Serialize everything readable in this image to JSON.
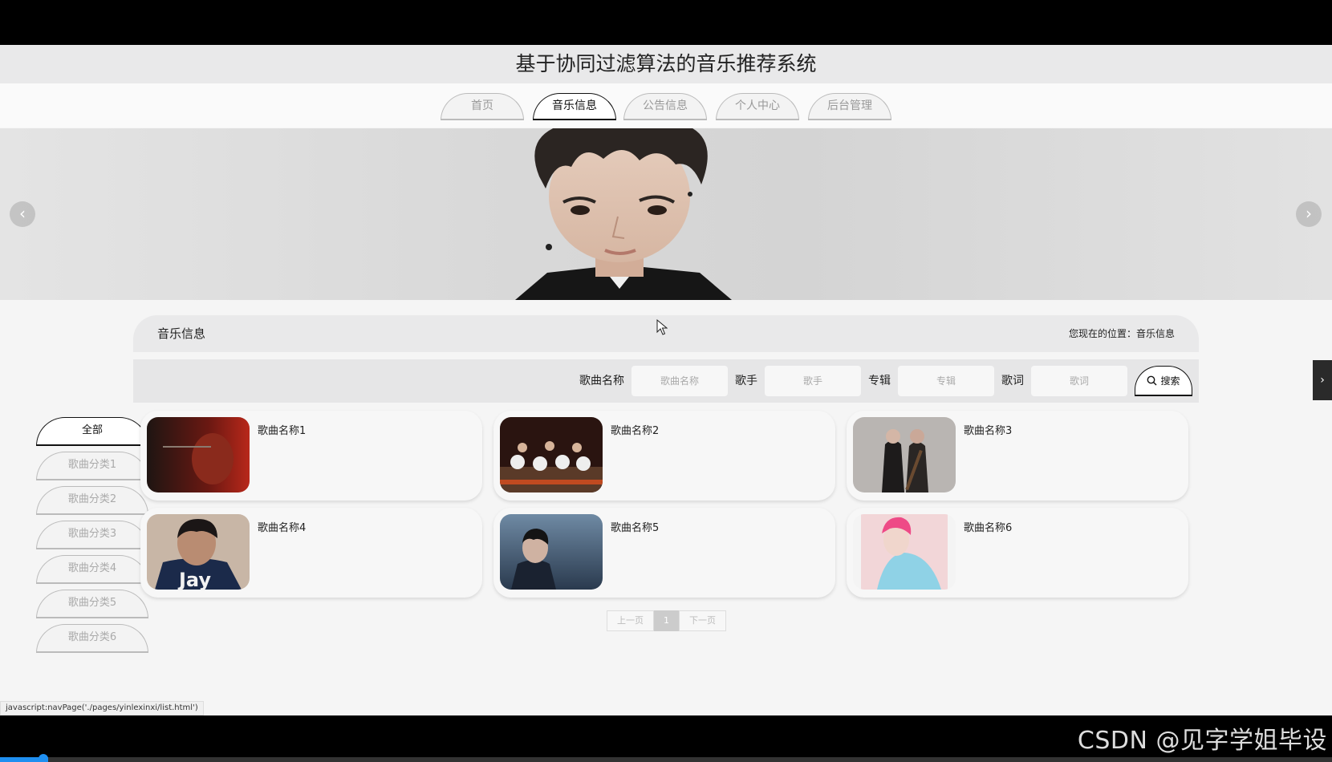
{
  "site": {
    "title": "基于协同过滤算法的音乐推荐系统"
  },
  "nav": {
    "tabs": [
      {
        "label": "首页",
        "active": false
      },
      {
        "label": "音乐信息",
        "active": true
      },
      {
        "label": "公告信息",
        "active": false
      },
      {
        "label": "个人中心",
        "active": false
      },
      {
        "label": "后台管理",
        "active": false
      }
    ]
  },
  "banner": {
    "prev_icon": "chevron-left-icon",
    "next_icon": "chevron-right-icon"
  },
  "section": {
    "title": "音乐信息",
    "location": "您现在的位置：音乐信息"
  },
  "search": {
    "fields": [
      {
        "label": "歌曲名称",
        "placeholder": "歌曲名称"
      },
      {
        "label": "歌手",
        "placeholder": "歌手"
      },
      {
        "label": "专辑",
        "placeholder": "专辑"
      },
      {
        "label": "歌词",
        "placeholder": "歌词"
      }
    ],
    "button_label": "搜索"
  },
  "categories": [
    {
      "label": "全部",
      "active": true
    },
    {
      "label": "歌曲分类1",
      "active": false
    },
    {
      "label": "歌曲分类2",
      "active": false
    },
    {
      "label": "歌曲分类3",
      "active": false
    },
    {
      "label": "歌曲分类4",
      "active": false
    },
    {
      "label": "歌曲分类5",
      "active": false
    },
    {
      "label": "歌曲分类6",
      "active": false
    }
  ],
  "songs": [
    {
      "name": "歌曲名称1"
    },
    {
      "name": "歌曲名称2"
    },
    {
      "name": "歌曲名称3"
    },
    {
      "name": "歌曲名称4",
      "cover_text": "Jay"
    },
    {
      "name": "歌曲名称5"
    },
    {
      "name": "歌曲名称6"
    }
  ],
  "pager": {
    "prev": "上一页",
    "current": "1",
    "next": "下一页"
  },
  "status_url": "javascript:navPage('./pages/yinlexinxi/list.html')",
  "watermark": "CSDN @见字学姐毕设",
  "colors": {
    "active_border": "#111111",
    "inactive_text": "#aaaaaa",
    "header_bg": "#e9e9ea"
  }
}
